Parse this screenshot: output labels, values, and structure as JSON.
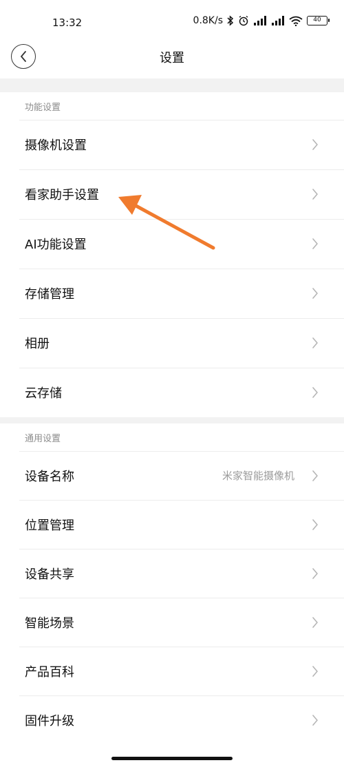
{
  "status_bar": {
    "time": "13:32",
    "network_speed": "0.8K/s",
    "battery_level": "40"
  },
  "nav": {
    "title": "设置",
    "back_icon": "chevron-left-icon"
  },
  "sections": {
    "function": {
      "header": "功能设置",
      "items": [
        {
          "label": "摄像机设置"
        },
        {
          "label": "看家助手设置"
        },
        {
          "label": "AI功能设置"
        },
        {
          "label": "存储管理"
        },
        {
          "label": "相册"
        },
        {
          "label": "云存储"
        }
      ]
    },
    "general": {
      "header": "通用设置",
      "items": [
        {
          "label": "设备名称",
          "value": "米家智能摄像机"
        },
        {
          "label": "位置管理"
        },
        {
          "label": "设备共享"
        },
        {
          "label": "智能场景"
        },
        {
          "label": "产品百科"
        },
        {
          "label": "固件升级"
        }
      ]
    }
  },
  "annotation": {
    "color": "#f07b2e"
  },
  "colors": {
    "background_band": "#f2f2f2",
    "chevron": "#b5b5b5",
    "secondary_text": "#8c8c8c"
  }
}
